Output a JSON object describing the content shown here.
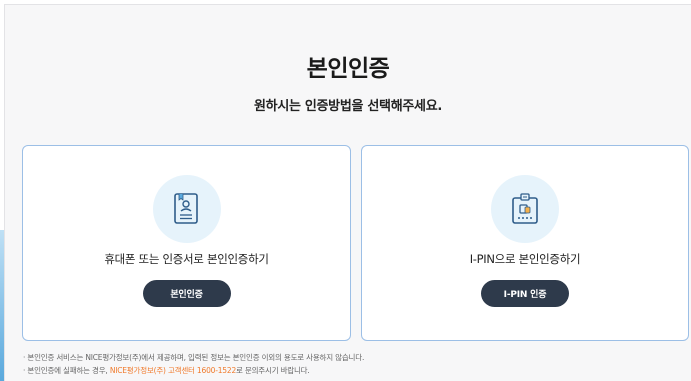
{
  "page": {
    "title": "본인인증",
    "subtitle": "원하시는 인증방법을 선택해주세요."
  },
  "cards": [
    {
      "icon": "phone-certificate-icon",
      "label": "휴대폰 또는 인증서로 본인인증하기",
      "button": "본인인증"
    },
    {
      "icon": "ipin-id-card-icon",
      "label": "I-PIN으로 본인인증하기",
      "button": "I-PIN 인증"
    }
  ],
  "notes": {
    "line1": "· 본인인증 서비스는 NICE평가정보(주)에서 제공하며, 입력된 정보는 본인인증 이외의 용도로 사용하지 않습니다.",
    "line2_prefix": "· 본인인증에 실패하는 경우, ",
    "line2_highlight": "NICE평가정보(주) 고객센터 1600-1522",
    "line2_suffix": "로 문의주시기 바랍니다."
  },
  "colors": {
    "accent_border": "#9cbfe6",
    "button_bg": "#2e3a4b",
    "highlight": "#f07a2b",
    "icon_bg": "#e6f3fb",
    "icon_stroke": "#2f5d8a"
  }
}
